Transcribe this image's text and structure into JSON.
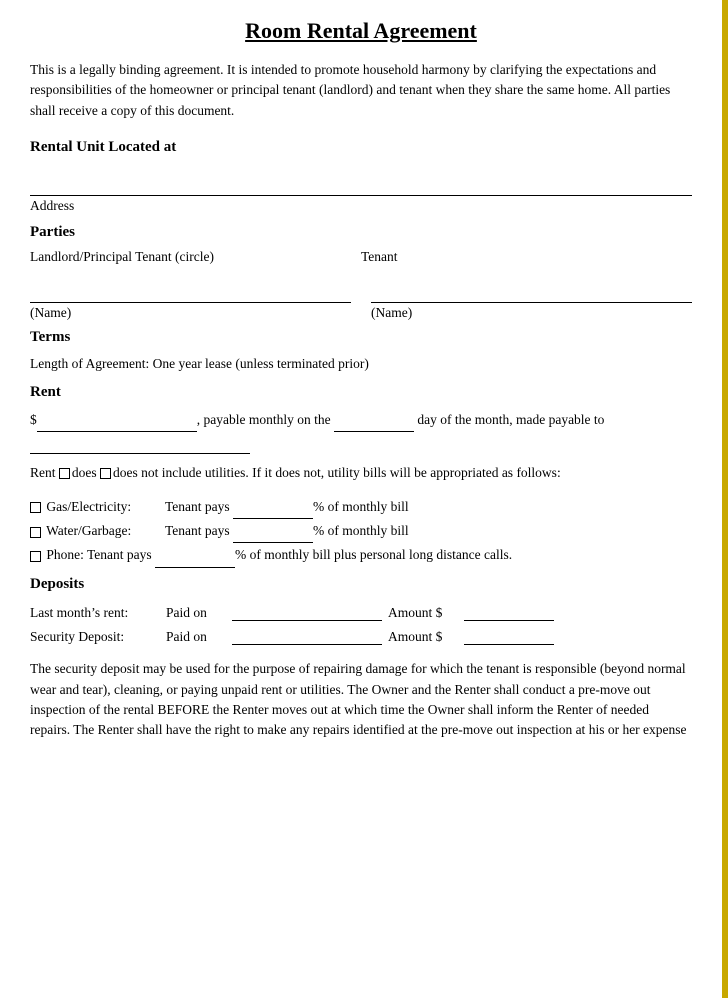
{
  "document": {
    "title": "Room Rental Agreement",
    "intro": "This is a legally binding agreement. It is intended to promote household harmony by clarifying the expectations and responsibilities of the homeowner or principal tenant (landlord) and tenant when they share the same home. All parties shall receive a copy of this document.",
    "sections": {
      "rental_unit": {
        "heading": "Rental Unit Located at",
        "address_label": "Address"
      },
      "parties": {
        "heading": "Parties",
        "landlord_label": "Landlord/Principal Tenant (circle)",
        "tenant_label": "Tenant",
        "name_label": "(Name)",
        "name_label2": "(Name)"
      },
      "terms": {
        "heading": "Terms",
        "length_text": "Length of Agreement: One year lease (unless terminated prior)"
      },
      "rent": {
        "heading": "Rent",
        "line1_prefix": "$",
        "line1_mid": ", payable monthly on the",
        "line1_suffix": "day of the month, made payable to",
        "utilities_text": "Rent □does □does not include utilities. If it does not, utility bills will be appropriated as follows:",
        "gas_label": "□ Gas/Electricity:",
        "gas_text": "Tenant pays",
        "gas_suffix": "% of monthly bill",
        "water_label": "□ Water/Garbage:",
        "water_text": "Tenant pays",
        "water_suffix": "% of monthly bill",
        "phone_label": "□ Phone: Tenant pays",
        "phone_suffix": "% of monthly bill plus personal long distance calls."
      },
      "deposits": {
        "heading": "Deposits",
        "last_month_label": "Last month’s rent:",
        "last_month_paid": "Paid on",
        "last_month_amount": "Amount $",
        "security_label": "Security Deposit:",
        "security_paid": "Paid on",
        "security_amount": "Amount $",
        "security_text": "The security deposit may be used for the purpose of repairing damage for which the tenant is responsible (beyond normal wear and tear), cleaning, or paying unpaid rent or utilities. The Owner and the Renter shall conduct a pre-move out inspection of the rental BEFORE the Renter moves out at which time the Owner shall inform the Renter of needed repairs. The Renter shall have the right to make any repairs identified at the pre-move out inspection at his or her expense"
      }
    }
  }
}
